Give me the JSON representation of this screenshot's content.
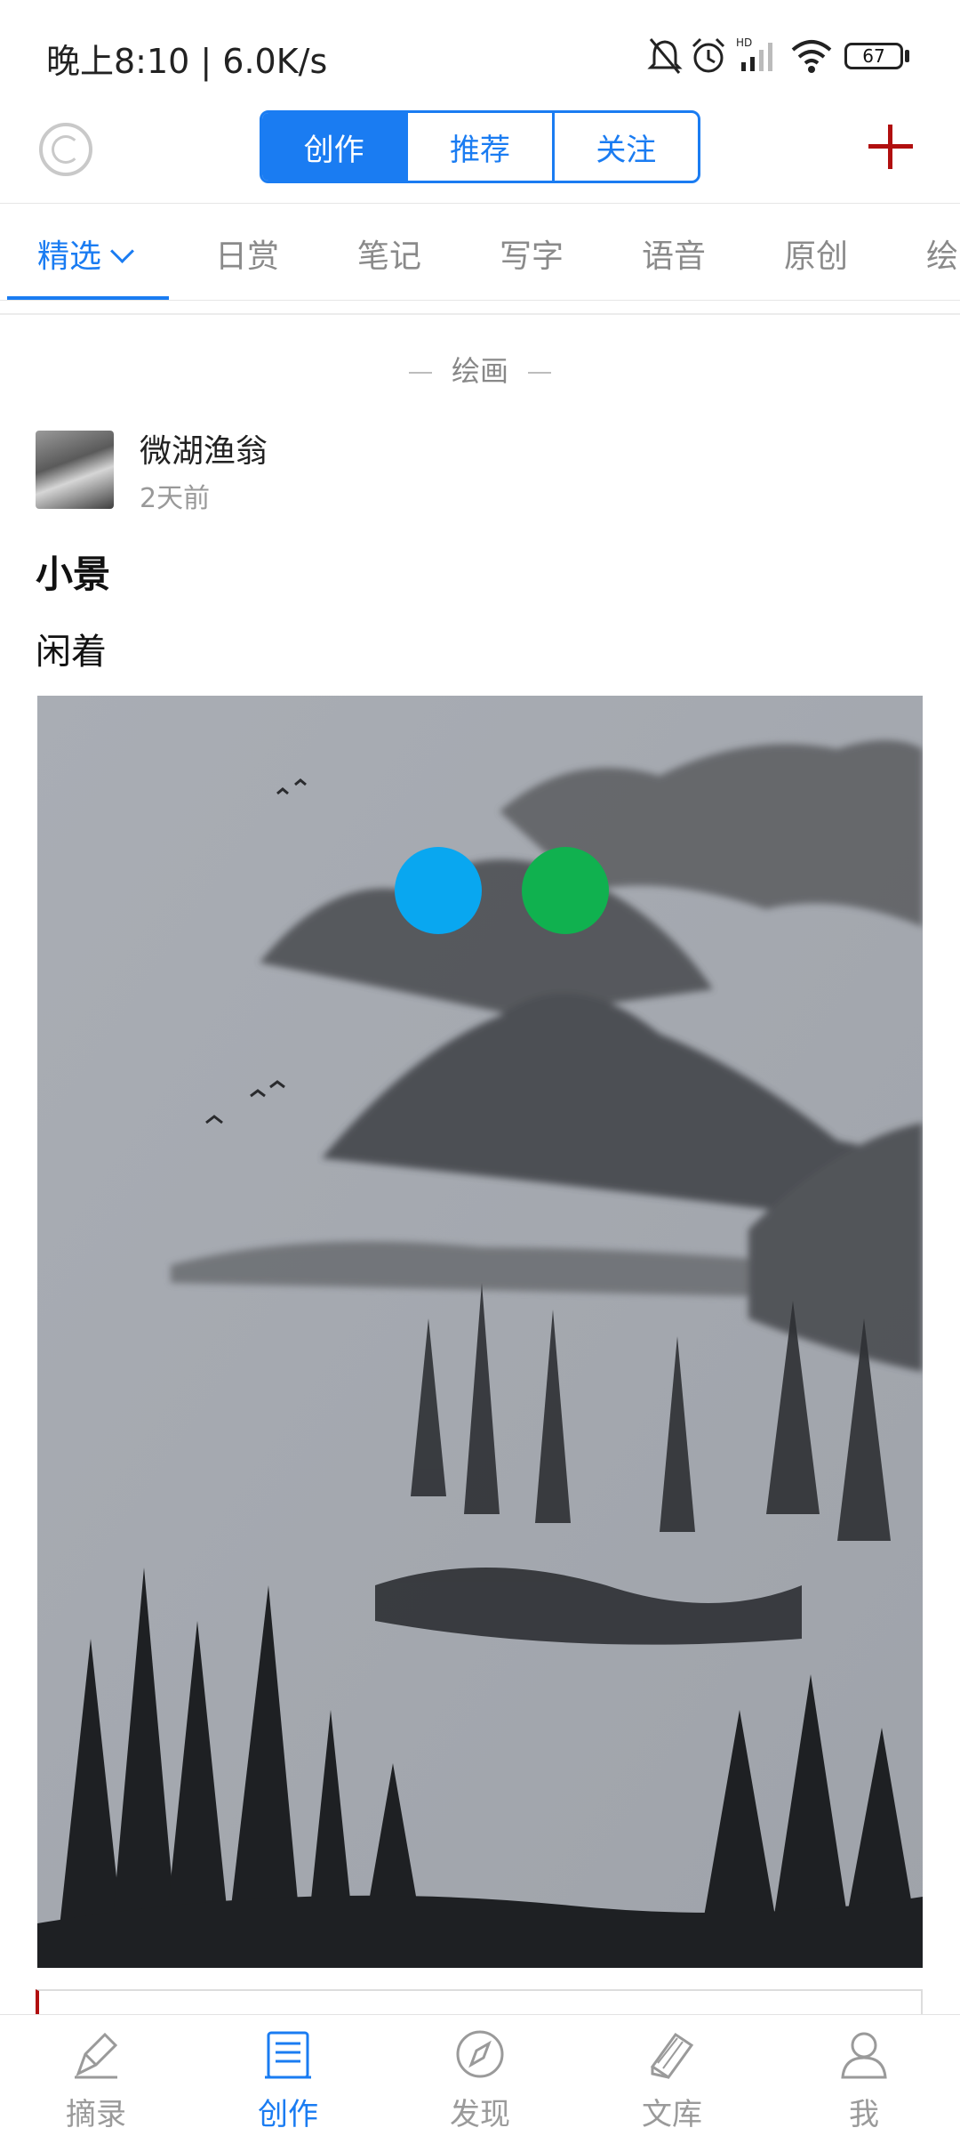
{
  "status_bar": {
    "time": "晚上8:10 | 6.0K/s",
    "battery": "67",
    "icons": [
      "mute-bell-icon",
      "alarm-icon",
      "hd-signal-icon",
      "wifi-icon",
      "battery-icon"
    ]
  },
  "top_bar": {
    "segments": [
      "创作",
      "推荐",
      "关注"
    ],
    "active_segment": "创作",
    "accent": "#1a7cf2",
    "add_color": "#b10f0f"
  },
  "category_tabs": [
    "精选",
    "日赏",
    "笔记",
    "写字",
    "语音",
    "原创",
    "绘"
  ],
  "active_category": "精选",
  "feed": {
    "section_label": "绘画",
    "author": "微湖渔翁",
    "time": "2天前",
    "title": "小景",
    "body": "闲着"
  },
  "overlay_dots": [
    "#09a7f0",
    "#10b14f"
  ],
  "bottom_nav": [
    {
      "label": "摘录",
      "icon": "pen-icon"
    },
    {
      "label": "创作",
      "icon": "document-icon"
    },
    {
      "label": "发现",
      "icon": "compass-icon"
    },
    {
      "label": "文库",
      "icon": "books-icon"
    },
    {
      "label": "我",
      "icon": "person-icon"
    }
  ],
  "active_nav": "创作"
}
